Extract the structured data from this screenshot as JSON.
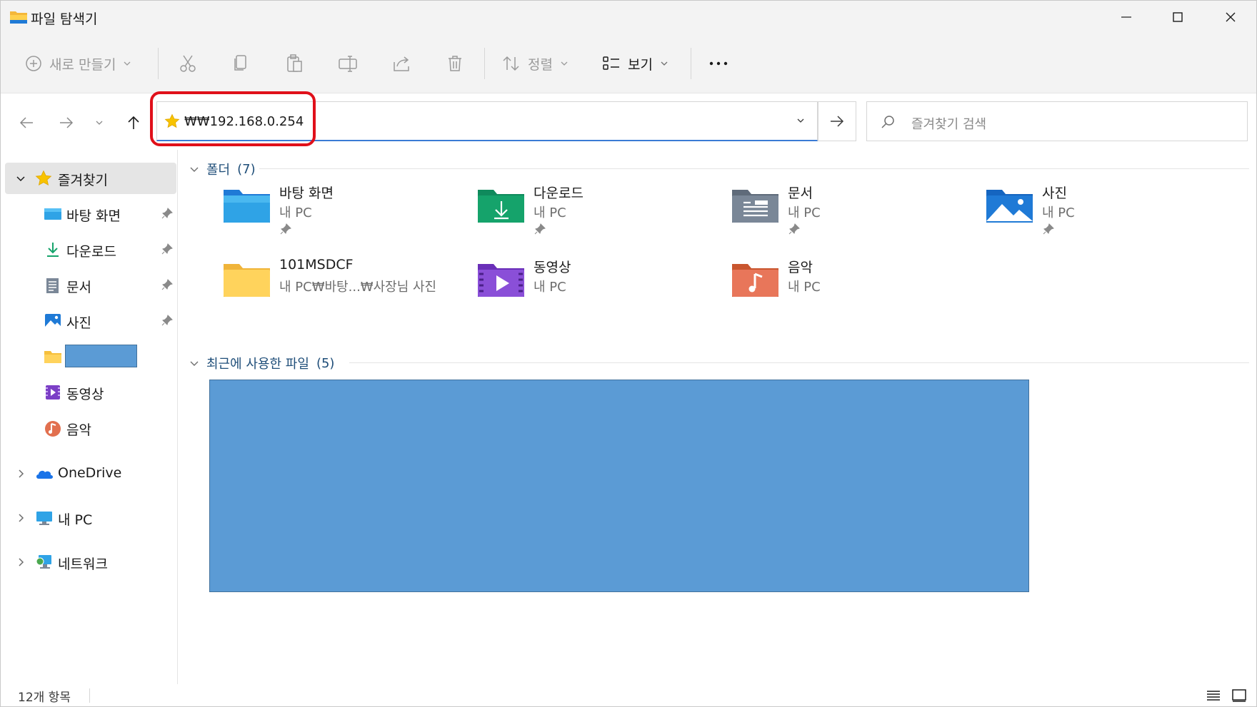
{
  "window": {
    "title": "파일 탐색기",
    "controls": [
      "minimize",
      "maximize",
      "close"
    ]
  },
  "commandbar": {
    "new_label": "새로 만들기",
    "sort_label": "정렬",
    "view_label": "보기",
    "more_label": "..."
  },
  "navigation": {
    "address": "₩₩192.168.0.254",
    "search_placeholder": "즐겨찾기 검색"
  },
  "sidebar": {
    "favorites": "즐겨찾기",
    "items": [
      {
        "label": "바탕 화면",
        "icon": "desktop-icon",
        "pinned": true
      },
      {
        "label": "다운로드",
        "icon": "download-icon",
        "pinned": true
      },
      {
        "label": "문서",
        "icon": "documents-icon",
        "pinned": true
      },
      {
        "label": "사진",
        "icon": "pictures-icon",
        "pinned": true
      },
      {
        "label": "",
        "icon": "folder-icon",
        "pinned": false
      },
      {
        "label": "동영상",
        "icon": "videos-icon",
        "pinned": false
      },
      {
        "label": "음악",
        "icon": "music-icon",
        "pinned": false
      }
    ],
    "onedrive": "OneDrive",
    "thispc": "내 PC",
    "network": "네트워크"
  },
  "content": {
    "folders_header": "폴더",
    "folders_count": "(7)",
    "folders": [
      {
        "name": "바탕 화면",
        "location": "내 PC",
        "pinned": true,
        "icon": "desktop-folder-icon"
      },
      {
        "name": "다운로드",
        "location": "내 PC",
        "pinned": true,
        "icon": "downloads-folder-icon"
      },
      {
        "name": "문서",
        "location": "내 PC",
        "pinned": true,
        "icon": "documents-folder-icon"
      },
      {
        "name": "사진",
        "location": "내 PC",
        "pinned": true,
        "icon": "pictures-folder-icon"
      },
      {
        "name": "101MSDCF",
        "location": "내 PC₩바탕...₩사장님 사진",
        "pinned": false,
        "icon": "folder-icon"
      },
      {
        "name": "동영상",
        "location": "내 PC",
        "pinned": false,
        "icon": "videos-folder-icon"
      },
      {
        "name": "음악",
        "location": "내 PC",
        "pinned": false,
        "icon": "music-folder-icon"
      }
    ],
    "recent_header": "최근에 사용한 파일",
    "recent_count": "(5)"
  },
  "status": {
    "item_count": "12개 항목"
  },
  "colors": {
    "accent": "#3a7bd5",
    "highlight": "#e0101a",
    "redaction": "#5b9bd5",
    "header_text": "#1f4e79"
  }
}
